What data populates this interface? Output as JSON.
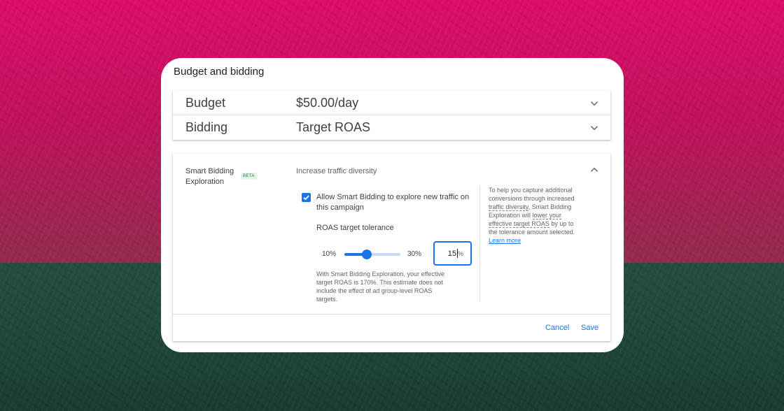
{
  "card": {
    "title": "Budget and bidding"
  },
  "budget": {
    "label": "Budget",
    "value": "$50.00/day",
    "expand_icon": "chevron-down-icon"
  },
  "bidding": {
    "label": "Bidding",
    "value": "Target ROAS",
    "expand_icon": "chevron-down-icon"
  },
  "exploration": {
    "label_line1": "Smart Bidding",
    "label_line2": "Exploration",
    "badge": "BETA",
    "subtitle": "Increase traffic diversity",
    "collapse_icon": "chevron-up-icon",
    "checkbox": {
      "checked": true,
      "label_line1": "Allow Smart Bidding to explore new traffic on",
      "label_line2": "this campaign"
    },
    "tolerance": {
      "title": "ROAS target tolerance",
      "min_label": "10%",
      "max_label": "30%",
      "min": 10,
      "max": 30,
      "value": 15,
      "input_value": "15",
      "input_suffix": "%"
    },
    "estimate_lines": [
      "With Smart Bidding Exploration, your effective",
      "target ROAS is 170%. This estimate does not",
      "include the effect of ad group-level ROAS",
      "targets."
    ],
    "help": {
      "line1": "To help you capture additional",
      "line2": "conversions through increased",
      "line3_dotted": "traffic diversity",
      "line3_rest": ", Smart Bidding",
      "line4_start": "Exploration will ",
      "line4_dotted": "lower your",
      "line5_dotted": "effective target ROAS",
      "line5_rest": " by up to",
      "line6": "the tolerance amount selected.",
      "link": "Learn more"
    }
  },
  "actions": {
    "cancel": "Cancel",
    "save": "Save"
  },
  "colors": {
    "accent": "#1a73e8",
    "beta_text": "#188038",
    "beta_bg": "#e6f4ea"
  }
}
